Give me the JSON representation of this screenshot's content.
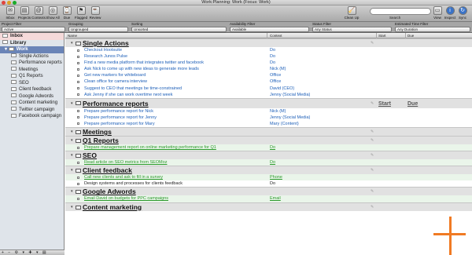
{
  "window": {
    "title": "Work:Planning: Work (Focus: Work)"
  },
  "toolbar": {
    "left": [
      {
        "label": "Inbox",
        "icon": "inbox-icon",
        "glyph": "✉"
      },
      {
        "label": "Projects",
        "icon": "projects-icon",
        "glyph": "▤"
      },
      {
        "label": "Contexts",
        "icon": "contexts-icon",
        "glyph": "@"
      },
      {
        "label": "Show All",
        "icon": "show-all-icon",
        "glyph": "◎"
      },
      {
        "label": "Due",
        "icon": "due-icon",
        "glyph": "⌚"
      },
      {
        "label": "Flagged",
        "icon": "flagged-icon",
        "glyph": "⚑"
      },
      {
        "label": "Review",
        "icon": "review-icon",
        "glyph": "☕"
      }
    ],
    "cleanup": {
      "label": "Clean Up",
      "glyph": "🧹"
    },
    "search": {
      "label": "Search",
      "placeholder": ""
    },
    "right": [
      {
        "label": "View",
        "icon": "view-icon",
        "glyph": "▭"
      },
      {
        "label": "Inspect",
        "icon": "inspect-icon",
        "glyph": "i"
      },
      {
        "label": "Sync",
        "icon": "sync-icon",
        "glyph": "↻"
      }
    ]
  },
  "filters": [
    {
      "label": "Project Filter",
      "value": "Active"
    },
    {
      "label": "Grouping",
      "value": "Ungrouped"
    },
    {
      "label": "Sorting",
      "value": "Unsorted"
    },
    {
      "label": "Availability Filter",
      "value": "Available"
    },
    {
      "label": "Status Filter",
      "value": "Any Status"
    },
    {
      "label": "Estimated Time Filter",
      "value": "Any Duration"
    }
  ],
  "sidebar": {
    "inbox": "Inbox",
    "library": "Library",
    "folder": "Work",
    "items": [
      "Single Actions",
      "Performance reports",
      "Meetings",
      "Q1 Reports",
      "SEO",
      "Client feedback",
      "Google Adwords",
      "Content marketing",
      "Twitter campaign",
      "Facebook campaign"
    ]
  },
  "columns": {
    "name": "Name",
    "context": "Context",
    "start": "Start",
    "due": "Due"
  },
  "projects": [
    {
      "name": "Single Actions",
      "tasks": [
        {
          "name": "Checkout Hootsuite",
          "context": "Do"
        },
        {
          "name": "Research Junos Pulse",
          "context": "Do"
        },
        {
          "name": "Find a new media platform that integrates twitter and facebook",
          "context": "Do"
        },
        {
          "name": "Ask Nick to come up with new ideas to generate more leads",
          "context": "Nick (M)"
        },
        {
          "name": "Get new markers for whiteboard",
          "context": "Office"
        },
        {
          "name": "Clean office for camera interview",
          "context": "Office"
        },
        {
          "name": "Suggest to CEO that meetings be time-constrained",
          "context": "David (CEO)"
        },
        {
          "name": "Ask Jenny if she can work overtime next week",
          "context": "Jenny (Social Media)"
        }
      ]
    },
    {
      "name": "Performance reports",
      "start": "Start",
      "due": "Due",
      "tasks": [
        {
          "name": "Prepare performance report for Nick",
          "context": "Nick (M)"
        },
        {
          "name": "Prepare performance report for Jenny",
          "context": "Jenny (Social Media)"
        },
        {
          "name": "Prepare performance report for Mary",
          "context": "Mary (Content)"
        }
      ]
    },
    {
      "name": "Meetings",
      "tasks": []
    },
    {
      "name": "Q1 Reports",
      "tasks": [
        {
          "name": "Prepare management report on online marketing performance for Q1",
          "context": "Do",
          "style": "green"
        }
      ]
    },
    {
      "name": "SEO",
      "tasks": [
        {
          "name": "Read article on SEO metrics from SEOMoz",
          "context": "Do",
          "style": "green"
        }
      ]
    },
    {
      "name": "Client feedback",
      "tasks": [
        {
          "name": "Call new clients and ask to fill in a survey",
          "context": "Phone",
          "style": "green"
        },
        {
          "name": "Design systems and processes for clients feedback",
          "context": "Do",
          "style": "black"
        }
      ]
    },
    {
      "name": "Google Adwords",
      "tasks": [
        {
          "name": "Email David on budgets for PPC campaigns",
          "context": "Email",
          "style": "green"
        }
      ]
    },
    {
      "name": "Content marketing",
      "tasks": []
    }
  ],
  "bottom_bar": "+ − ⚙ ▾ ✚ ▾ ▤"
}
